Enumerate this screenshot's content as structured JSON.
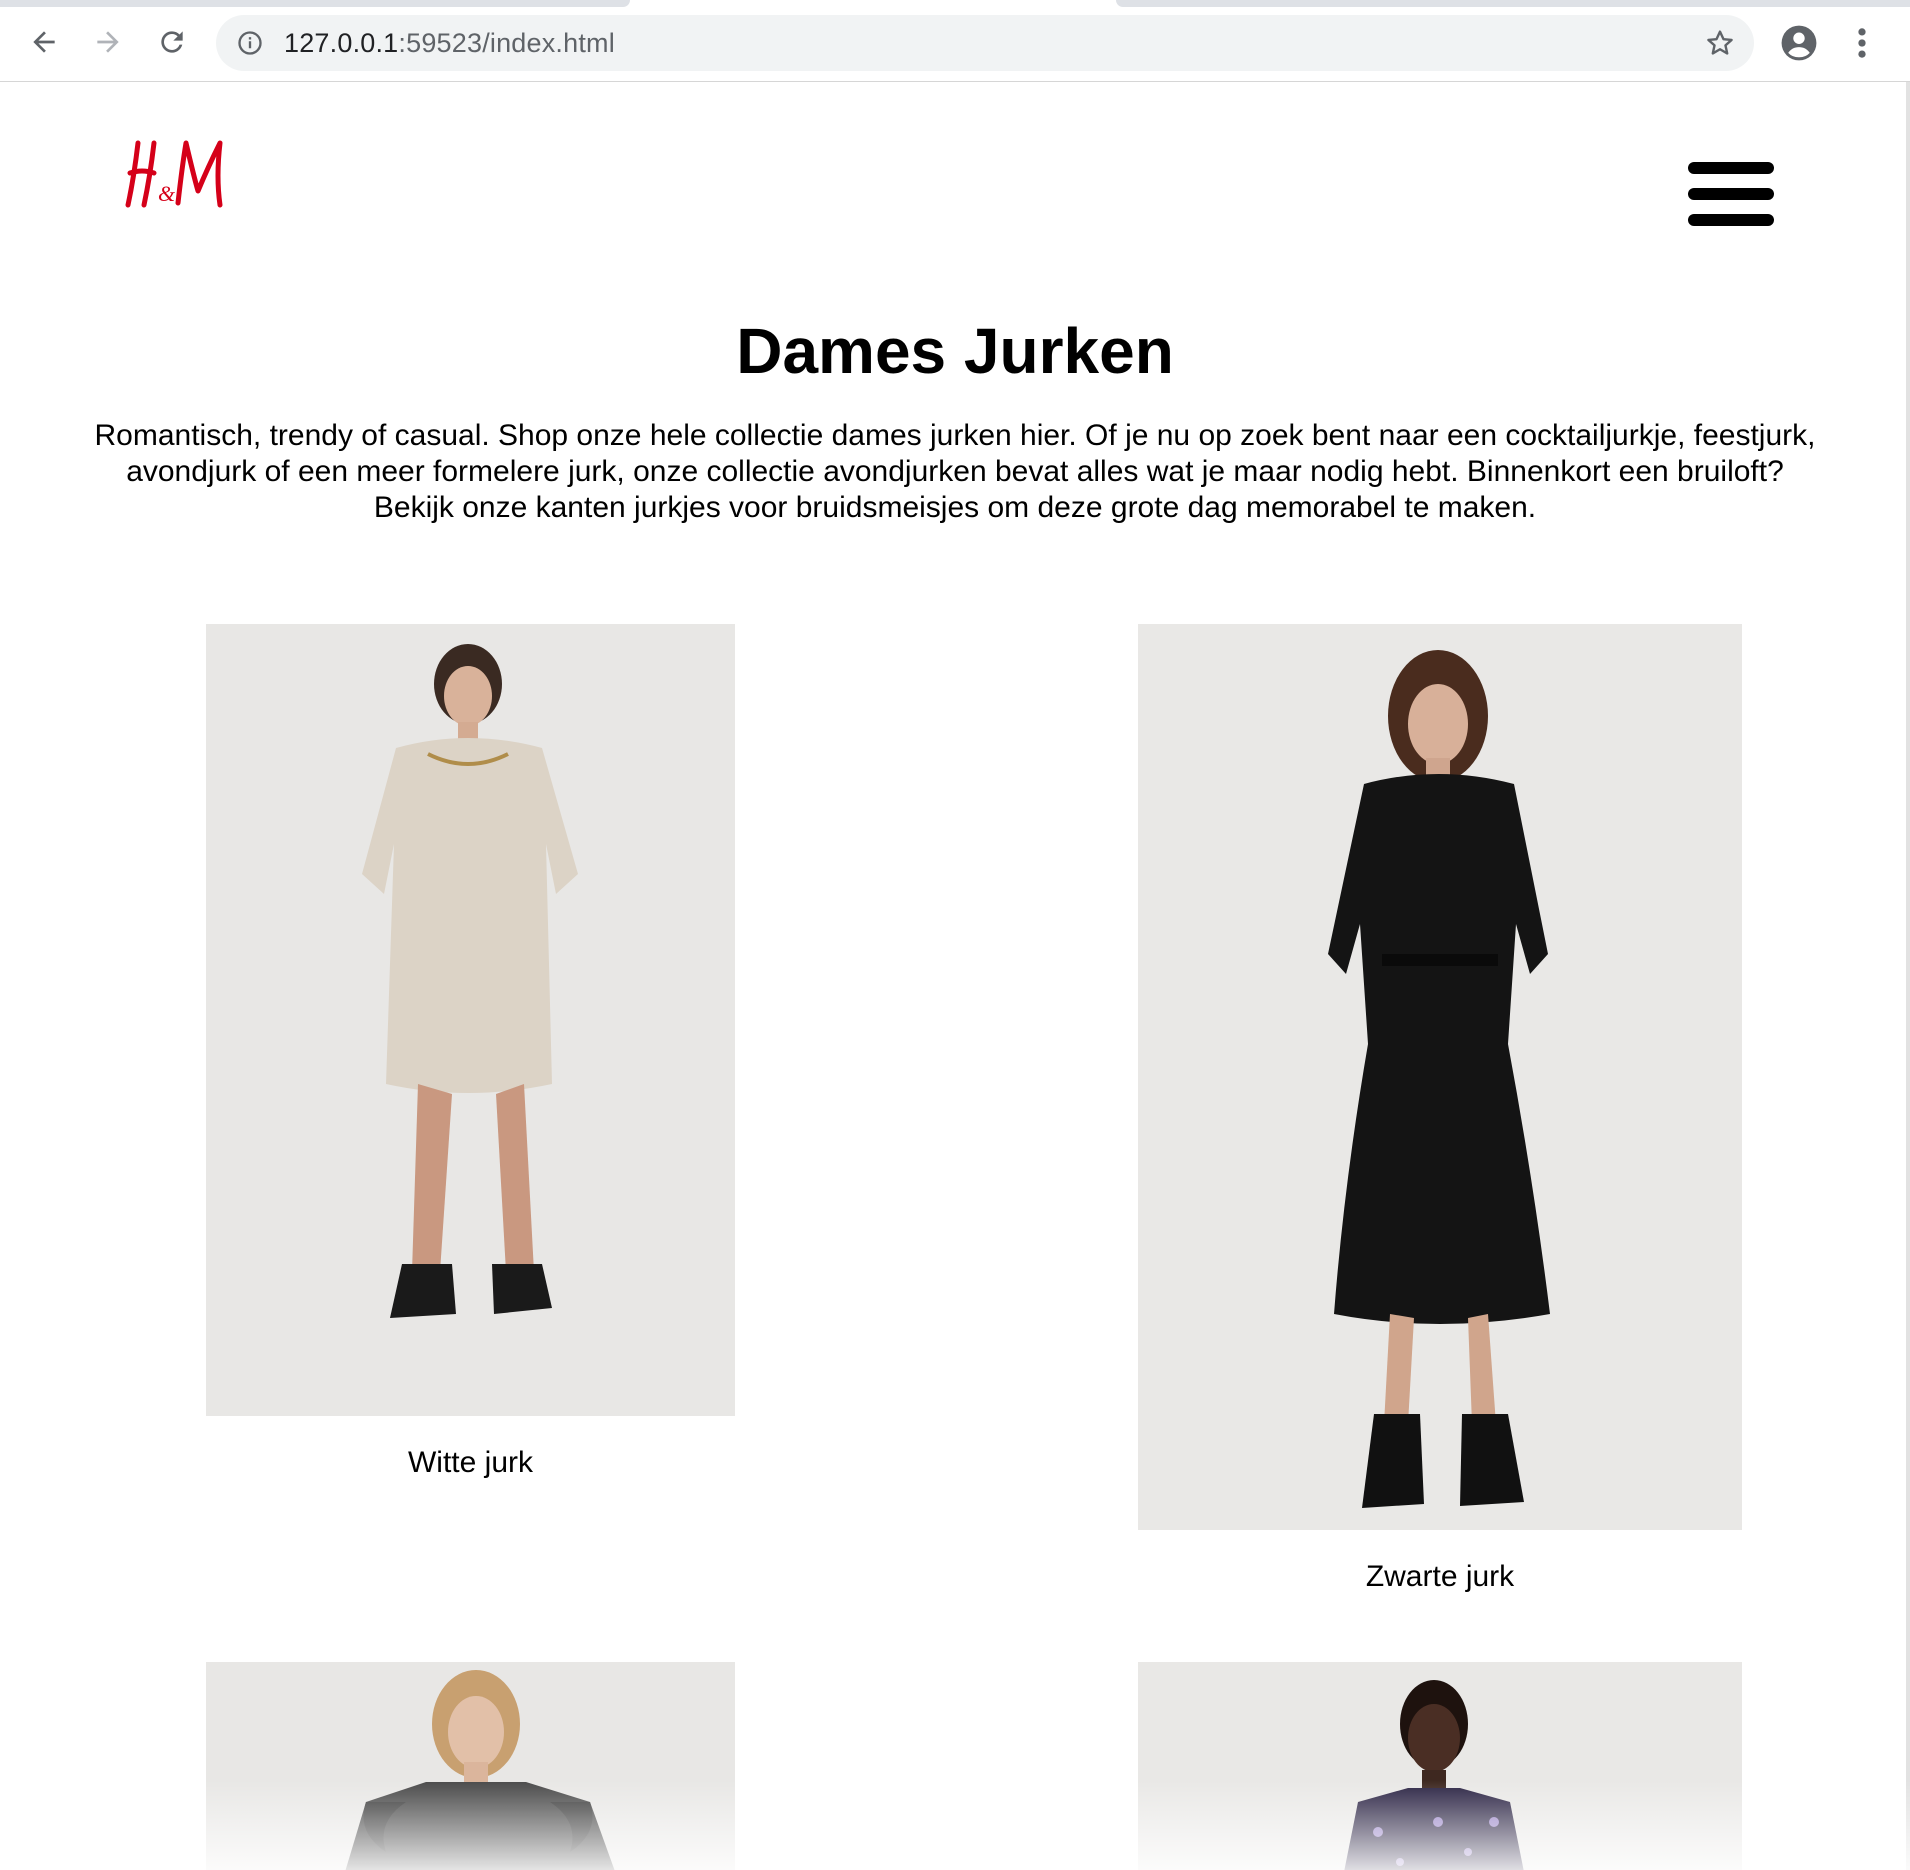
{
  "browser": {
    "url_host": "127.0.0.1",
    "url_rest": ":59523/index.html",
    "icons": {
      "back": "arrow-left-icon",
      "forward": "arrow-right-icon",
      "reload": "reload-icon",
      "site_info": "info-icon",
      "bookmark": "star-icon",
      "profile": "account-circle-icon",
      "menu": "vertical-dots-icon"
    }
  },
  "header": {
    "logo_text": "H&M",
    "logo_color": "#d50019",
    "menu_icon": "hamburger-menu-icon"
  },
  "main": {
    "title": "Dames Jurken",
    "intro": "Romantisch, trendy of casual. Shop onze hele collectie dames jurken hier. Of je nu op zoek bent naar een cocktailjurkje, feestjurk, avondjurk of een meer formelere jurk, onze collectie avondjurken bevat alles wat je maar nodig hebt. Binnenkort een bruiloft? Bekijk onze kanten jurkjes voor bruidsmeisjes om deze grote dag memorabel te maken.",
    "products": [
      {
        "name": "Witte jurk"
      },
      {
        "name": "Zwarte jurk"
      }
    ]
  }
}
